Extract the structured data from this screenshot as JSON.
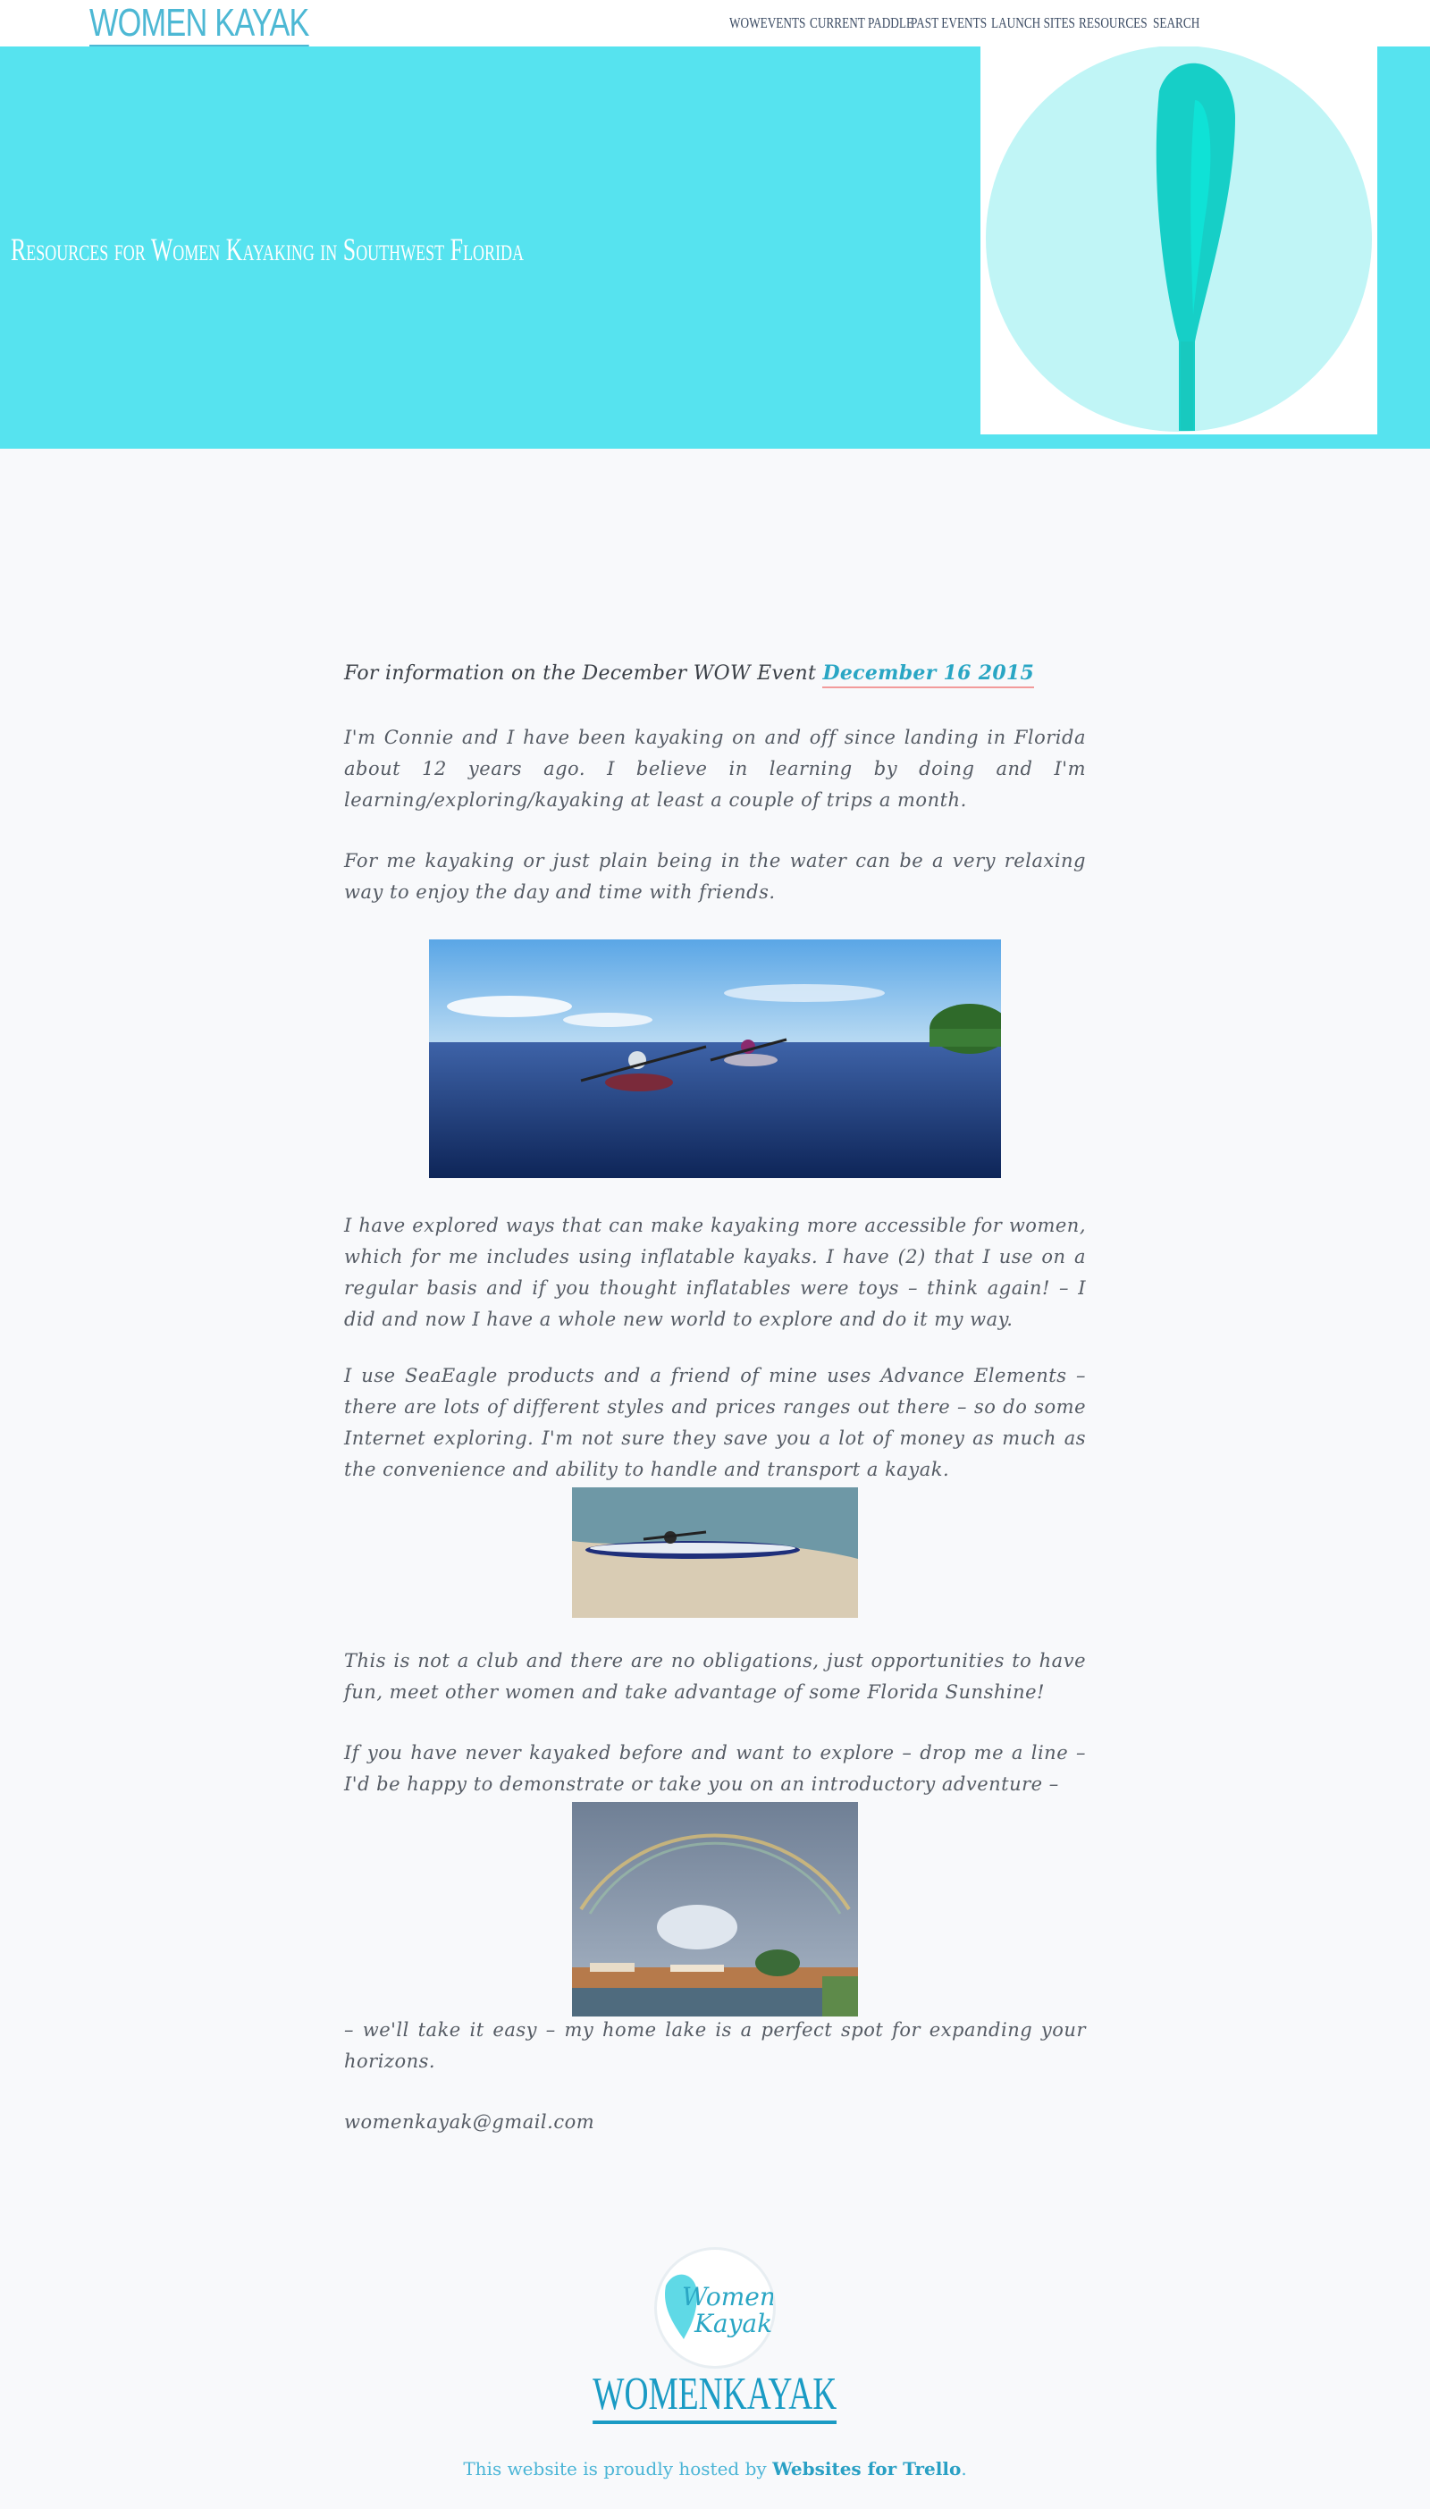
{
  "header": {
    "logo": "WOMEN KAYAK",
    "nav": [
      "WOWEVENTS",
      "CURRENT PADDLE",
      "PAST EVENTS",
      "LAUNCH SITES",
      "RESOURCES",
      "SEARCH"
    ]
  },
  "hero": {
    "title": "Resources for Women Kayaking in Southwest Florida"
  },
  "content": {
    "lead_text": "For information on the December WOW Event",
    "lead_link": "December 16 2015",
    "paragraphs": [
      "I'm Connie and I have been kayaking on and off since landing in Florida about 12 years ago. I believe in learning by doing and I'm learning/exploring/kayaking at least a couple of trips a month.",
      "For me kayaking or just plain being in the water can be a very relaxing way to enjoy the day and time with friends.",
      "I have explored ways that can make kayaking more accessible for women, which for me includes using inflatable kayaks. I have (2) that I use on a regular basis and if you thought inflatables were toys – think again! – I did and now I have a whole new world to explore and do it my way.",
      "I use SeaEagle products and a friend of mine uses Advance Elements – there are lots of different styles and prices ranges out there – so do some Internet exploring. I'm not sure they save you a lot of money as much as the convenience and ability to handle and transport a kayak.",
      "This is not a club and there are no obligations, just opportunities to have fun, meet other women and take advantage of some Florida Sunshine!",
      "If you have never kayaked before and want to explore – drop me a line – I'd be happy to demonstrate or take you on an introductory adventure –",
      "– we'll take it easy – my home lake is a perfect spot for expanding your horizons.",
      "womenkayak@gmail.com"
    ]
  },
  "footer": {
    "logo_line1": "Women",
    "logo_line2": "Kayak",
    "title": "WOMENKAYAK",
    "hosted_prefix": "This website is proudly hosted by ",
    "hosted_link": "Websites for Trello",
    "hosted_suffix": "."
  },
  "colors": {
    "hero_bg": "#56e3ef",
    "accent": "#4db8d4",
    "link": "#2aa6c4"
  }
}
